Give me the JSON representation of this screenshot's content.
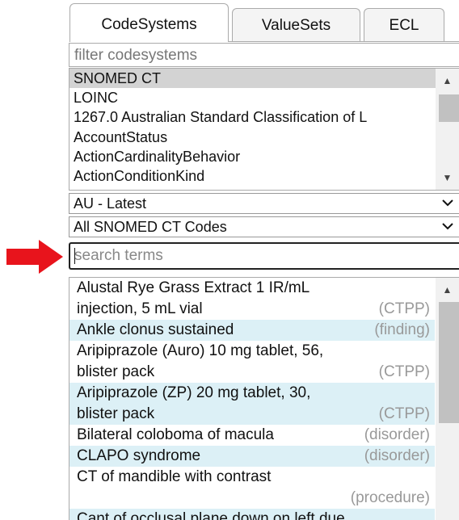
{
  "tabs": [
    {
      "label": "CodeSystems",
      "active": true
    },
    {
      "label": "ValueSets",
      "active": false
    },
    {
      "label": "ECL",
      "active": false
    }
  ],
  "filter": {
    "placeholder": "filter codesystems"
  },
  "codesystems": [
    {
      "label": "SNOMED CT",
      "selected": true
    },
    {
      "label": "LOINC"
    },
    {
      "label": "1267.0 Australian Standard Classification of L"
    },
    {
      "label": "AccountStatus"
    },
    {
      "label": "ActionCardinalityBehavior"
    },
    {
      "label": "ActionConditionKind"
    }
  ],
  "version_select": {
    "value": "AU - Latest"
  },
  "scope_select": {
    "value": "All SNOMED CT Codes"
  },
  "search": {
    "placeholder": "search terms"
  },
  "results": [
    {
      "term_line1": "Alustal Rye Grass Extract 1 IR/mL",
      "term_line2": "injection, 5 mL vial",
      "tag": "(CTPP)"
    },
    {
      "term_line1": "Ankle clonus sustained",
      "tag": "(finding)"
    },
    {
      "term_line1": "Aripiprazole (Auro) 10 mg tablet, 56,",
      "term_line2": "blister pack",
      "tag": "(CTPP)"
    },
    {
      "term_line1": "Aripiprazole (ZP) 20 mg tablet, 30,",
      "term_line2": "blister pack",
      "tag": "(CTPP)"
    },
    {
      "term_line1": "Bilateral coloboma of macula",
      "tag": "(disorder)"
    },
    {
      "term_line1": "CLAPO syndrome",
      "tag": "(disorder)"
    },
    {
      "term_line1": "CT of mandible with contrast",
      "tag": "(procedure)",
      "tag_on_own_line": true
    },
    {
      "term_line1": "Cant of occlusal plane down on left due"
    }
  ],
  "colors": {
    "selected_row": "#d3d3d3",
    "alt_row": "#dcf0f6",
    "pointer_arrow": "#e8141c"
  }
}
